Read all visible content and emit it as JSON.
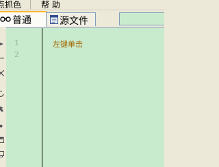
{
  "menubar": {
    "items": [
      {
        "label": "点抓色"
      },
      {
        "label": "帮 助"
      }
    ]
  },
  "tabs": [
    {
      "label": "普通",
      "icon": "glasses-icon",
      "active": true
    },
    {
      "label": "源文件",
      "icon": "document-icon",
      "active": false
    }
  ],
  "editor": {
    "line_numbers": [
      "1",
      "2"
    ],
    "lines": [
      "左键单击",
      ""
    ]
  },
  "colors": {
    "editor_background": "#c9ebcd",
    "line_number": "#9cb69f",
    "code_text": "#a06400",
    "active_tab_accent": "#ffb72f"
  }
}
